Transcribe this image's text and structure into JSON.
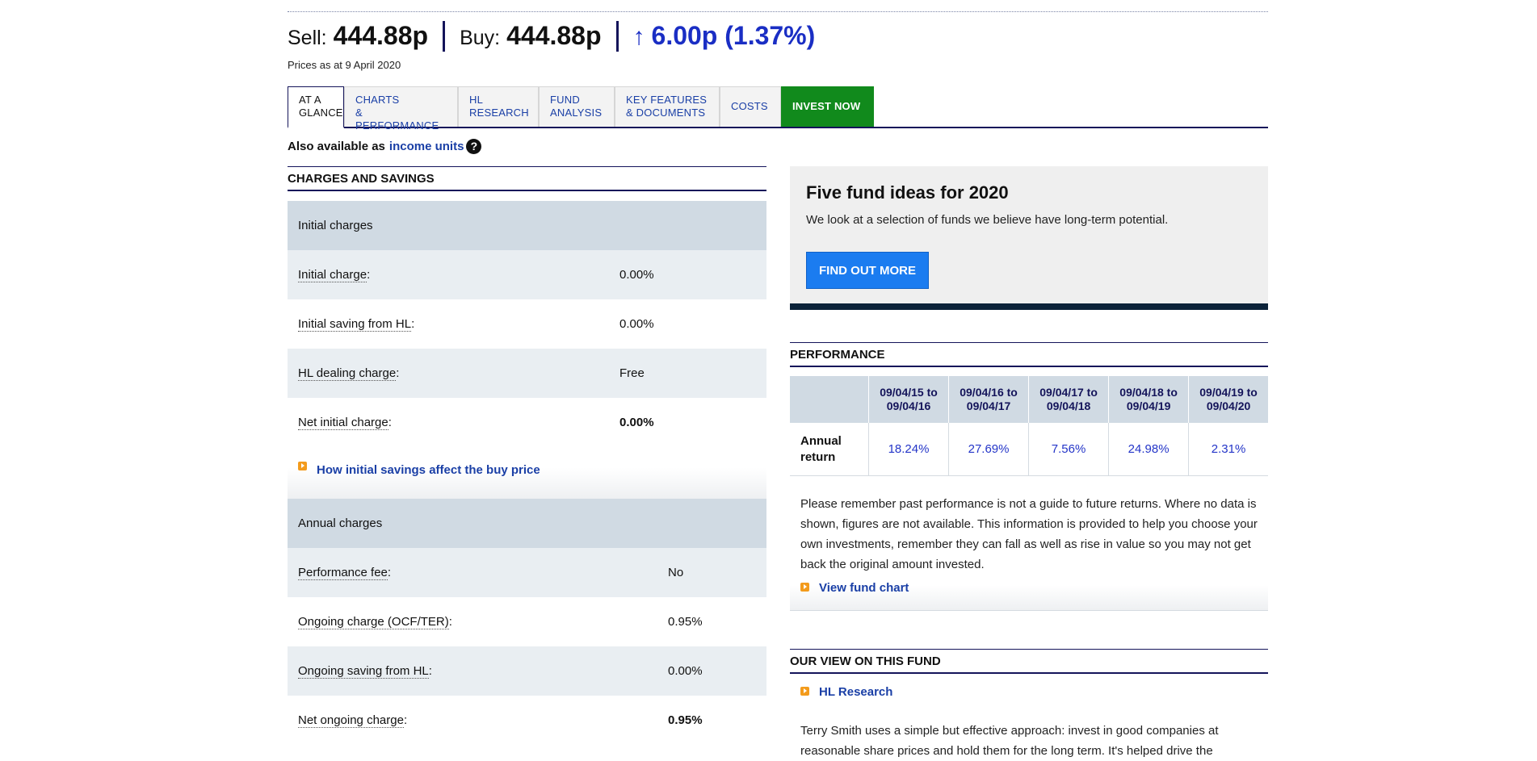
{
  "price": {
    "sell_label": "Sell:",
    "sell_value": "444.88p",
    "buy_label": "Buy:",
    "buy_value": "444.88p",
    "change_arrow": "↑",
    "change_value": "6.00p (1.37%)",
    "as_of": "Prices as at 9 April 2020"
  },
  "tabs": [
    {
      "line1": "AT A",
      "line2": "GLANCE"
    },
    {
      "line1": "CHARTS",
      "line2": "& PERFORMANCE"
    },
    {
      "line1": "HL",
      "line2": "RESEARCH"
    },
    {
      "line1": "FUND",
      "line2": "ANALYSIS"
    },
    {
      "line1": "KEY FEATURES",
      "line2": "& DOCUMENTS"
    },
    {
      "line1": "COSTS"
    },
    {
      "line1": "INVEST NOW"
    }
  ],
  "also_available": {
    "prefix": "Also available as",
    "link": "income units",
    "help_icon": "?"
  },
  "charges": {
    "title": "CHARGES AND SAVINGS",
    "initial_header": "Initial charges",
    "initial_rows": [
      {
        "label": "Initial charge",
        "value": "0.00%"
      },
      {
        "label": "Initial saving from HL",
        "value": "0.00%"
      },
      {
        "label": "HL dealing charge",
        "value": "Free"
      },
      {
        "label": "Net initial charge",
        "value": "0.00%"
      }
    ],
    "initial_link": "How initial savings affect the buy price",
    "annual_header": "Annual charges",
    "annual_rows": [
      {
        "label": "Performance fee",
        "value": "No"
      },
      {
        "label": "Ongoing charge (OCF/TER)",
        "value": "0.95%"
      },
      {
        "label": "Ongoing saving from HL",
        "value": "0.00%"
      },
      {
        "label": "Net ongoing charge",
        "value": "0.95%"
      }
    ]
  },
  "promo": {
    "title": "Five fund ideas for 2020",
    "text": "We look at a selection of funds we believe have long-term potential.",
    "button": "FIND OUT MORE"
  },
  "performance": {
    "title": "PERFORMANCE",
    "columns": [
      {
        "from": "09/04/15 to",
        "to": "09/04/16"
      },
      {
        "from": "09/04/16 to",
        "to": "09/04/17"
      },
      {
        "from": "09/04/17 to",
        "to": "09/04/18"
      },
      {
        "from": "09/04/18 to",
        "to": "09/04/19"
      },
      {
        "from": "09/04/19 to",
        "to": "09/04/20"
      }
    ],
    "row_label_1": "Annual",
    "row_label_2": "return",
    "values": [
      "18.24%",
      "27.69%",
      "7.56%",
      "24.98%",
      "2.31%"
    ],
    "note": "Please remember past performance is not a guide to future returns. Where no data is shown, figures are not available. This information is provided to help you choose your own investments, remember they can fall as well as rise in value so you may not get back the original amount invested.",
    "link": "View fund chart"
  },
  "our_view": {
    "title": "OUR VIEW ON THIS FUND",
    "link": "HL Research",
    "text": "Terry Smith uses a simple but effective approach: invest in good companies at reasonable share prices and hold them for the long term. It's helped drive the"
  },
  "colors": {
    "navy": "#14145a",
    "link": "#1a3fa6",
    "invest_green": "#118a1c",
    "cta_blue": "#1b7cf0",
    "row_header": "#d0dae3",
    "row_alt": "#e9eef2"
  }
}
